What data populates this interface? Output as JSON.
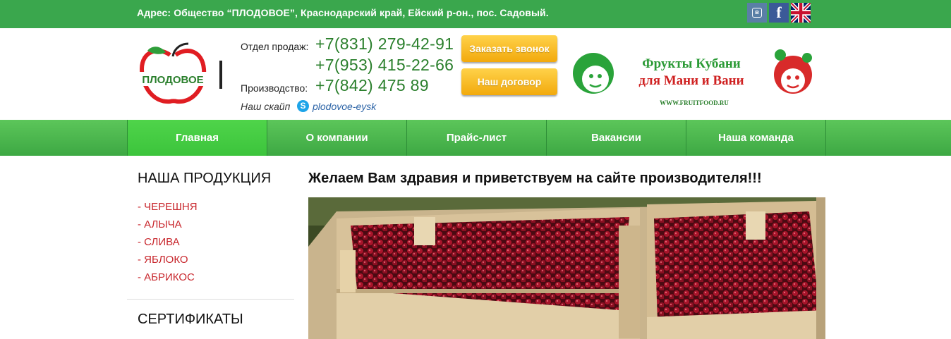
{
  "topbar": {
    "address": "Адрес: Общество “ПЛОДОВОЕ”, Краснодарский край, Ейский р-он., пос. Садовый.",
    "social": [
      {
        "icon": "vk-icon",
        "label": "в"
      },
      {
        "icon": "facebook-icon",
        "label": "f"
      },
      {
        "icon": "uk-flag-icon",
        "label": ""
      }
    ]
  },
  "header": {
    "logo_text": "ПЛОДОВОЕ",
    "sales_label": "Отдел продаж:",
    "sales_phone_1": "+7(831) 279-42-91",
    "sales_phone_2": "+7(953) 415-22-66",
    "production_label": "Производство:",
    "production_phone": "+7(842) 475 89",
    "skype_label": "Наш скайп",
    "skype_id": "plodovoe-eysk",
    "callback_button": "Заказать звонок",
    "contract_button": "Наш договор",
    "banner": {
      "line1": "Фрукты Кубани",
      "line2": "для Мани и Вани",
      "url": "WWW.FRUITFOOD.RU"
    }
  },
  "nav": {
    "items": [
      "Главная",
      "О компании",
      "Прайс-лист",
      "Вакансии",
      "Наша команда"
    ]
  },
  "sidebar": {
    "products_title": "НАША ПРОДУКЦИЯ",
    "products": [
      "- ЧЕРЕШНЯ",
      "- АЛЫЧА",
      "- СЛИВА",
      "- ЯБЛОКО",
      "- АБРИКОС"
    ],
    "certificates_title": "СЕРТИФИКАТЫ"
  },
  "main": {
    "welcome": "Желаем Вам здравия и приветствуем на сайте производителя!!!"
  },
  "colors": {
    "brand_green": "#3aa74d",
    "nav_green": "#4cbf4f",
    "phone_green": "#2a7f2c",
    "product_red": "#c8272d",
    "button_yellow": "#f7bd1f"
  }
}
